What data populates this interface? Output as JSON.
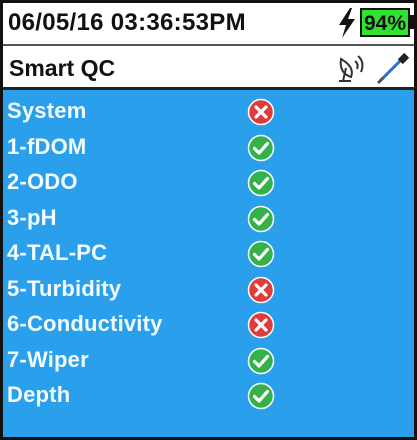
{
  "status_bar": {
    "datetime": "06/05/16 03:36:53PM",
    "battery_percent": "94%",
    "battery_color": "#31e331"
  },
  "header": {
    "title": "Smart QC",
    "icons": [
      "satellite-dish-icon",
      "probe-icon"
    ]
  },
  "colors": {
    "content_background": "#2aa0ec",
    "pass": "#33b24a",
    "fail": "#e23b3b"
  },
  "sensors": [
    {
      "label": "System",
      "status": "fail"
    },
    {
      "label": "1-fDOM",
      "status": "pass"
    },
    {
      "label": "2-ODO",
      "status": "pass"
    },
    {
      "label": "3-pH",
      "status": "pass"
    },
    {
      "label": "4-TAL-PC",
      "status": "pass"
    },
    {
      "label": "5-Turbidity",
      "status": "fail"
    },
    {
      "label": "6-Conductivity",
      "status": "fail"
    },
    {
      "label": "7-Wiper",
      "status": "pass"
    },
    {
      "label": "Depth",
      "status": "pass"
    }
  ]
}
